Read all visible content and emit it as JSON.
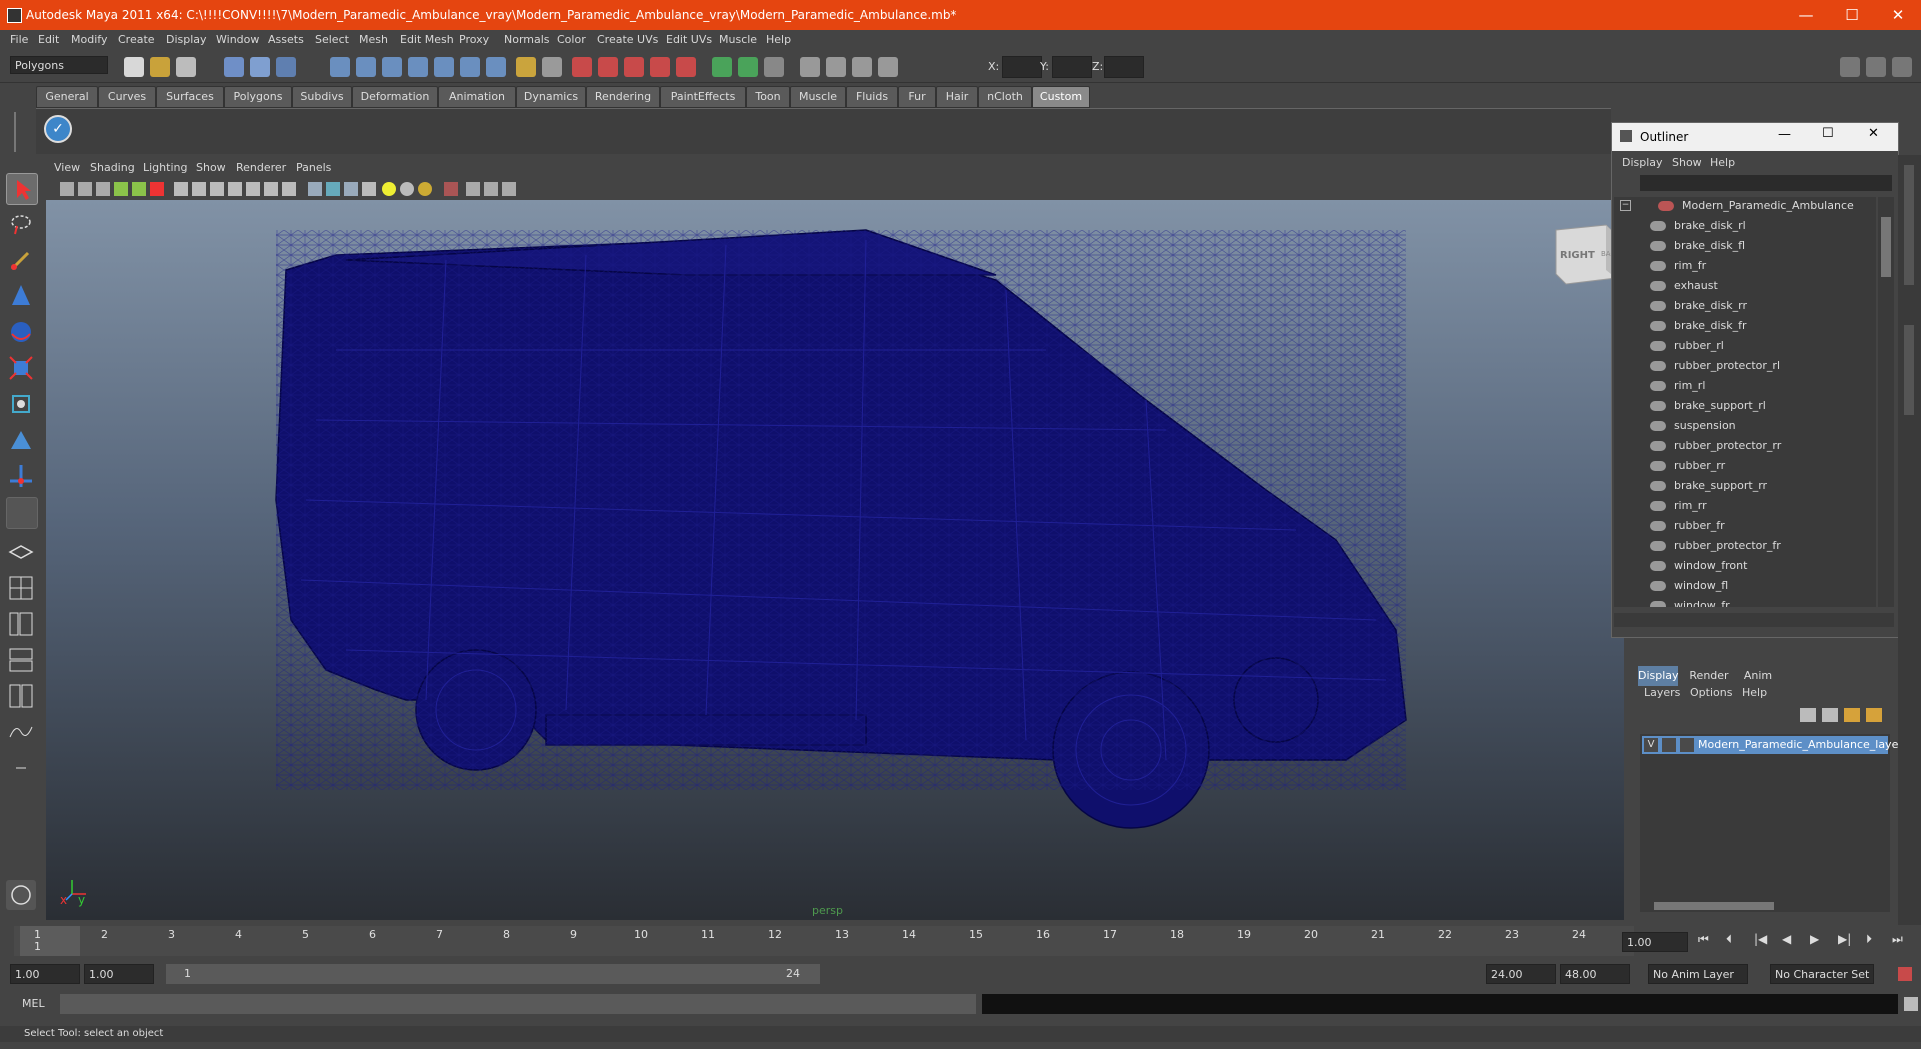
{
  "window": {
    "title": "Autodesk Maya 2011 x64: C:\\!!!!CONV!!!!\\7\\Modern_Paramedic_Ambulance_vray\\Modern_Paramedic_Ambulance_vray\\Modern_Paramedic_Ambulance.mb*",
    "minimize": "—",
    "maximize": "☐",
    "close": "✕"
  },
  "menu": [
    "File",
    "Edit",
    "Modify",
    "Create",
    "Display",
    "Window",
    "Assets",
    "Select",
    "Mesh",
    "Edit Mesh",
    "Proxy",
    "Normals",
    "Color",
    "Create UVs",
    "Edit UVs",
    "Muscle",
    "Help"
  ],
  "toolbar": {
    "mode": "Polygons",
    "x_label": "X:",
    "y_label": "Y:",
    "z_label": "Z:"
  },
  "shelf_tabs": [
    "General",
    "Curves",
    "Surfaces",
    "Polygons",
    "Subdivs",
    "Deformation",
    "Animation",
    "Dynamics",
    "Rendering",
    "PaintEffects",
    "Toon",
    "Muscle",
    "Fluids",
    "Fur",
    "Hair",
    "nCloth",
    "Custom"
  ],
  "panel_menu": [
    "View",
    "Shading",
    "Lighting",
    "Show",
    "Renderer",
    "Panels"
  ],
  "viewport": {
    "camera": "persp",
    "viewcube_right": "RIGHT",
    "viewcube_back": "BACK",
    "axis_x": "x",
    "axis_y": "y"
  },
  "outliner": {
    "title": "Outliner",
    "menu": [
      "Display",
      "Show",
      "Help"
    ],
    "root": "Modern_Paramedic_Ambulance",
    "items": [
      "brake_disk_rl",
      "brake_disk_fl",
      "rim_fr",
      "exhaust",
      "brake_disk_rr",
      "brake_disk_fr",
      "rubber_rl",
      "rubber_protector_rl",
      "rim_rl",
      "brake_support_rl",
      "suspension",
      "rubber_protector_rr",
      "rubber_rr",
      "brake_support_rr",
      "rim_rr",
      "rubber_fr",
      "rubber_protector_fr",
      "window_front",
      "window_fl",
      "window_fr"
    ]
  },
  "layer_editor": {
    "tabs": [
      "Display",
      "Render",
      "Anim"
    ],
    "menu": [
      "Layers",
      "Options",
      "Help"
    ],
    "layer_visible": "V",
    "layer_name": "Modern_Paramedic_Ambulance_layer"
  },
  "timeline": {
    "ticks": [
      "1",
      "2",
      "3",
      "4",
      "5",
      "6",
      "7",
      "8",
      "9",
      "10",
      "11",
      "12",
      "13",
      "14",
      "15",
      "16",
      "17",
      "18",
      "19",
      "20",
      "21",
      "22",
      "23",
      "24"
    ],
    "current_frame_marker": "1",
    "current_frame": "1.00"
  },
  "range": {
    "start": "1.00",
    "playback_start": "1.00",
    "slider_start": "1",
    "slider_end": "24",
    "playback_end": "24.00",
    "end": "48.00",
    "anim_layer": "No Anim Layer",
    "character_set": "No Character Set"
  },
  "command": {
    "label": "MEL"
  },
  "help_line": "Select Tool: select an object",
  "colors": {
    "titlebar": "#e54510",
    "wireframe": "#0d0d6e",
    "active_tab": "#8a8a8a",
    "layer_highlight": "#5d8fc7"
  }
}
